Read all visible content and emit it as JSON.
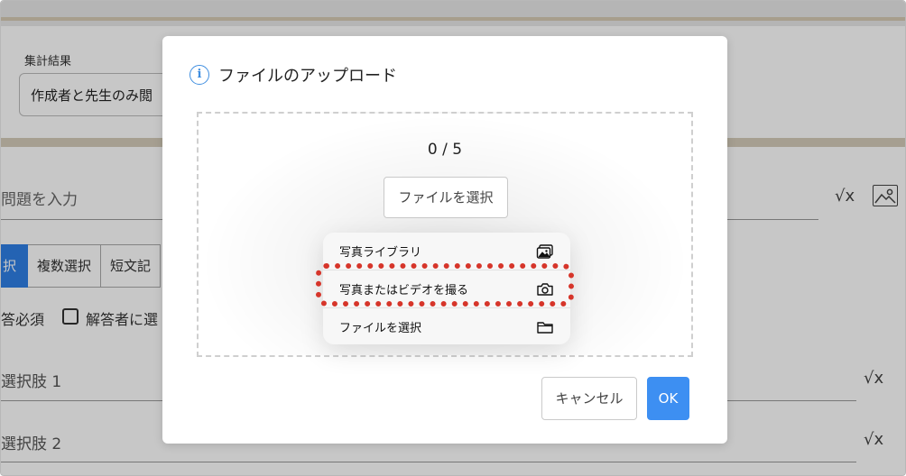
{
  "background": {
    "card_label": "集計結果",
    "select_value": "作成者と先生のみ閲",
    "question_placeholder": "問題を入力",
    "sqrt_symbol": "√x",
    "tabs": [
      {
        "label": "択",
        "active": true
      },
      {
        "label": "複数選択",
        "active": false
      },
      {
        "label": "短文記",
        "active": false
      }
    ],
    "required_label": "答必須",
    "checkbox_label": "解答者に選",
    "choices": [
      "選択肢 1",
      "選択肢 2"
    ]
  },
  "modal": {
    "title": "ファイルのアップロード",
    "counter": "0 / 5",
    "select_file_button": "ファイルを選択",
    "popup_menu": [
      {
        "label": "写真ライブラリ",
        "icon": "photo-library-icon"
      },
      {
        "label": "写真またはビデオを撮る",
        "icon": "camera-icon"
      },
      {
        "label": "ファイルを選択",
        "icon": "folder-icon"
      }
    ],
    "cancel_button": "キャンセル",
    "ok_button": "OK"
  },
  "colors": {
    "accent": "#3d8ff2",
    "highlight": "#d6352a",
    "info": "#3f8ee0"
  }
}
